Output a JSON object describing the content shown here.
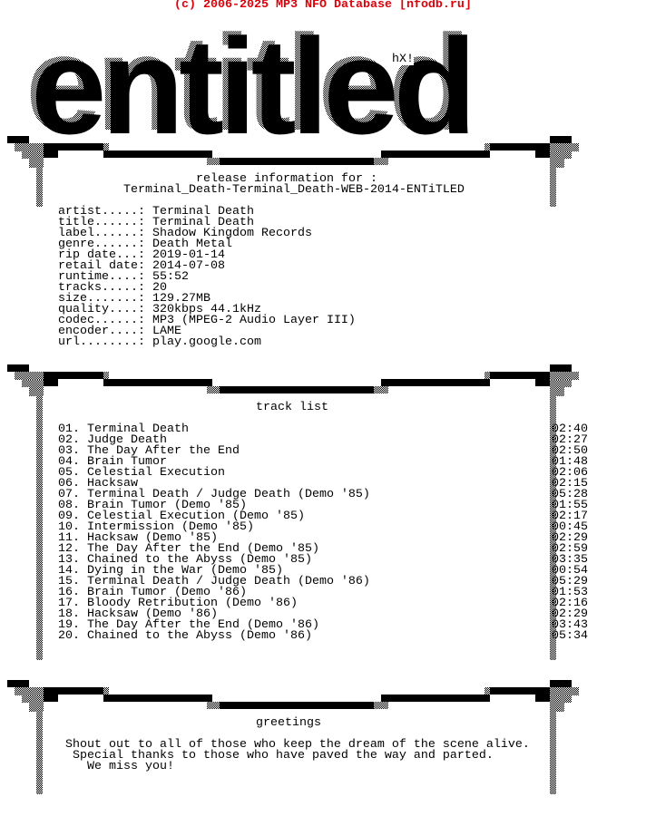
{
  "header": {
    "copyright": "(c) 2006-2025 MP3 NFO Database [nfodb.ru]"
  },
  "logo": {
    "text": "entitled",
    "tag": "hX!"
  },
  "release": {
    "heading": "release information for :",
    "name": "Terminal_Death-Terminal_Death-WEB-2014-ENTiTLED",
    "info": [
      {
        "label": "artist.....:",
        "value": "Terminal Death"
      },
      {
        "label": "title......:",
        "value": "Terminal Death"
      },
      {
        "label": "label......:",
        "value": "Shadow Kingdom Records"
      },
      {
        "label": "genre......:",
        "value": "Death Metal"
      },
      {
        "label": "rip date...:",
        "value": "2019-01-14"
      },
      {
        "label": "retail date:",
        "value": "2014-07-08"
      },
      {
        "label": "runtime....:",
        "value": "55:52"
      },
      {
        "label": "tracks.....:",
        "value": "20"
      },
      {
        "label": "size.......:",
        "value": "129.27MB"
      },
      {
        "label": "quality....:",
        "value": "320kbps 44.1kHz"
      },
      {
        "label": "codec......:",
        "value": "MP3 (MPEG-2 Audio Layer III)"
      },
      {
        "label": "encoder....:",
        "value": "LAME"
      },
      {
        "label": "url........:",
        "value": "play.google.com"
      }
    ]
  },
  "tracklist": {
    "heading": "track list",
    "tracks": [
      {
        "num": "01.",
        "title": "Terminal Death",
        "time": "02:40"
      },
      {
        "num": "02.",
        "title": "Judge Death",
        "time": "02:27"
      },
      {
        "num": "03.",
        "title": "The Day After the End",
        "time": "02:50"
      },
      {
        "num": "04.",
        "title": "Brain Tumor",
        "time": "01:48"
      },
      {
        "num": "05.",
        "title": "Celestial Execution",
        "time": "02:06"
      },
      {
        "num": "06.",
        "title": "Hacksaw",
        "time": "02:15"
      },
      {
        "num": "07.",
        "title": "Terminal Death / Judge Death (Demo '85)",
        "time": "05:28"
      },
      {
        "num": "08.",
        "title": "Brain Tumor (Demo '85)",
        "time": "01:55"
      },
      {
        "num": "09.",
        "title": "Celestial Execution (Demo '85)",
        "time": "02:17"
      },
      {
        "num": "10.",
        "title": "Intermission (Demo '85)",
        "time": "00:45"
      },
      {
        "num": "11.",
        "title": "Hacksaw (Demo '85)",
        "time": "02:29"
      },
      {
        "num": "12.",
        "title": "The Day After the End (Demo '85)",
        "time": "02:59"
      },
      {
        "num": "13.",
        "title": "Chained to the Abyss (Demo '85)",
        "time": "03:35"
      },
      {
        "num": "14.",
        "title": "Dying in the War (Demo '85)",
        "time": "00:54"
      },
      {
        "num": "15.",
        "title": "Terminal Death / Judge Death (Demo '86)",
        "time": "05:29"
      },
      {
        "num": "16.",
        "title": "Brain Tumor (Demo '86)",
        "time": "01:53"
      },
      {
        "num": "17.",
        "title": "Bloody Retribution (Demo '86)",
        "time": "02:16"
      },
      {
        "num": "18.",
        "title": "Hacksaw (Demo '86)",
        "time": "02:29"
      },
      {
        "num": "19.",
        "title": "The Day After the End (Demo '86)",
        "time": "03:43"
      },
      {
        "num": "20.",
        "title": "Chained to the Abyss (Demo '86)",
        "time": "05:34"
      }
    ]
  },
  "greetings": {
    "heading": "greetings",
    "lines": [
      "Shout out to all of those who keep the dream of the scene alive.",
      "Special thanks to those who have paved the way and parted.",
      "We miss you!"
    ]
  }
}
